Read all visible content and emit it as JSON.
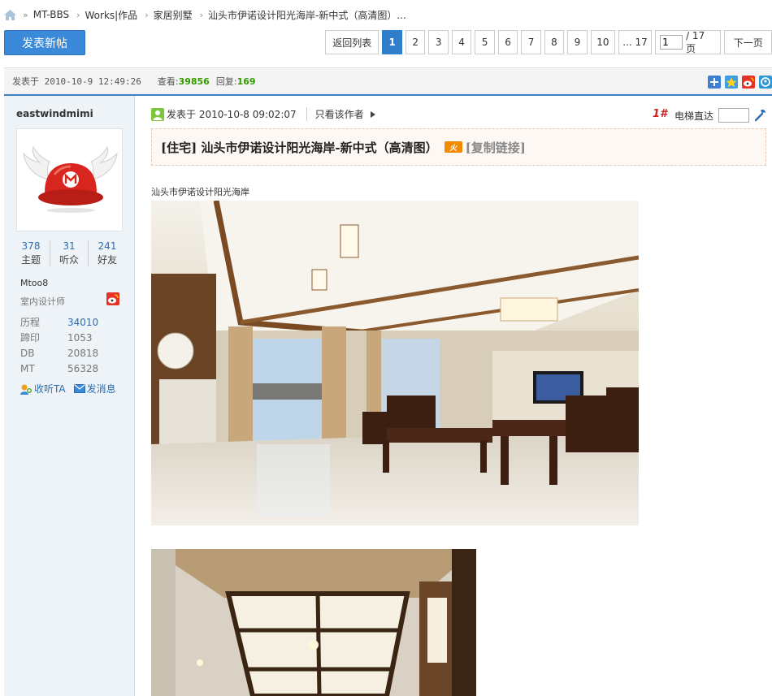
{
  "breadcrumb": {
    "items": [
      "MT-BBS",
      "Works|作品",
      "家居别墅",
      "汕头市伊诺设计阳光海岸-新中式（高清图）..."
    ]
  },
  "toolbar": {
    "post_label": "发表新帖",
    "back_label": "返回列表",
    "pages": [
      "1",
      "2",
      "3",
      "4",
      "5",
      "6",
      "7",
      "8",
      "9",
      "10",
      "... 17"
    ],
    "current_page": "1",
    "page_input_value": "1",
    "page_total": "/ 17 页",
    "next_label": "下一页"
  },
  "post_bar": {
    "posted": "发表于 2010-10-9 12:49:26",
    "views_label": "查看:",
    "views": "39856",
    "replies_label": "回复:",
    "replies": "169"
  },
  "user": {
    "name": "eastwindmimi",
    "counts": [
      {
        "num": "378",
        "label": "主题"
      },
      {
        "num": "31",
        "label": "听众"
      },
      {
        "num": "241",
        "label": "好友"
      }
    ],
    "uid": "Mtoo8",
    "title": "室内设计师",
    "info": [
      {
        "k": "历程",
        "v": "34010"
      },
      {
        "k": "蹄印",
        "v": "1053"
      },
      {
        "k": "DB",
        "v": "20818"
      },
      {
        "k": "MT",
        "v": "56328"
      }
    ],
    "follow_label": "收听TA",
    "message_label": "发消息"
  },
  "post": {
    "posted": "发表于 2010-10-8 09:02:07",
    "only_author": "只看该作者",
    "floor": "1#",
    "elevator": "电梯直达",
    "title": "[住宅] 汕头市伊诺设计阳光海岸-新中式（高清图）",
    "fire_badge": "火",
    "copy_link": "[复制链接]",
    "caption": "汕头市伊诺设计阳光海岸"
  },
  "colors": {
    "accent": "#3b8ad9",
    "link": "#2a6db4",
    "stat_green": "#339900",
    "floor_red": "#cc2222"
  }
}
